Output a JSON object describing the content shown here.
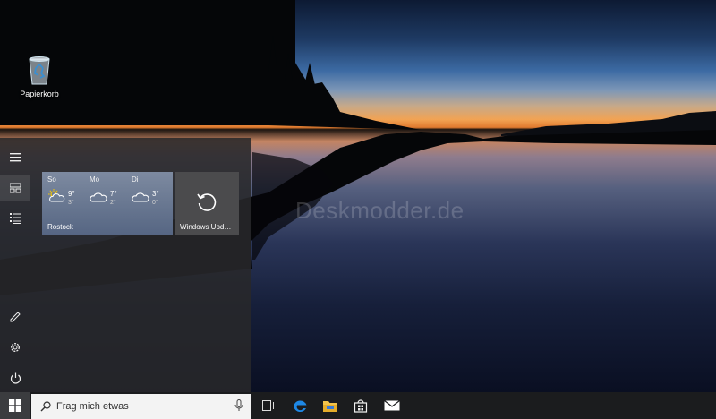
{
  "desktop": {
    "recycle_bin_label": "Papierkorb",
    "watermark": "Deskmodder.de"
  },
  "start_menu": {
    "rail_icons": [
      "hamburger-menu-icon",
      "tiles-view-icon",
      "all-apps-list-icon",
      "pen-icon",
      "gear-icon",
      "power-icon"
    ],
    "weather_tile": {
      "city": "Rostock",
      "days": [
        {
          "day": "So",
          "high": "9°",
          "low": "3°",
          "icon": "sun-cloud-icon"
        },
        {
          "day": "Mo",
          "high": "7°",
          "low": "2°",
          "icon": "cloud-icon"
        },
        {
          "day": "Di",
          "high": "3°",
          "low": "0°",
          "icon": "cloud-icon"
        }
      ]
    },
    "update_tile": {
      "label": "Windows Upd…",
      "icon": "refresh-icon"
    }
  },
  "taskbar": {
    "search_placeholder": "Frag mich etwas",
    "pinned": [
      "task-view-icon",
      "edge-icon",
      "file-explorer-icon",
      "store-icon",
      "mail-icon"
    ],
    "accent": "#0078d7"
  }
}
